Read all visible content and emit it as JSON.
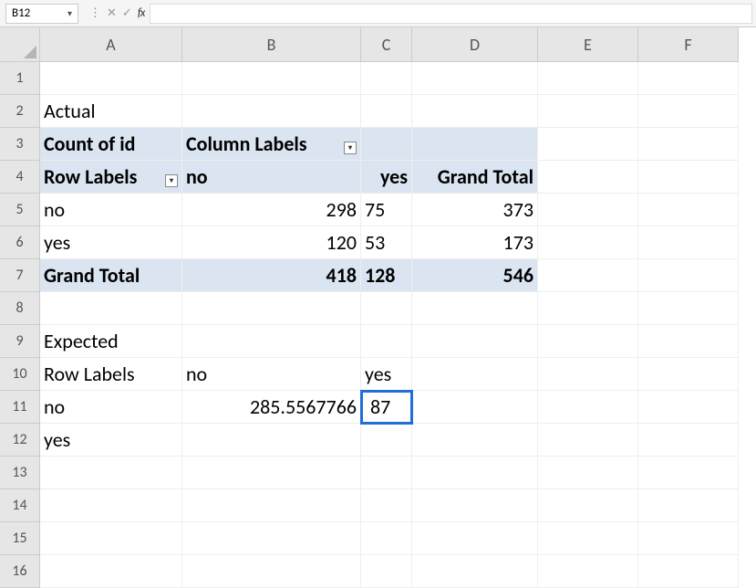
{
  "name_box": "B12",
  "fx_label": "fx",
  "columns": [
    "A",
    "B",
    "C",
    "D",
    "E",
    "F"
  ],
  "rows": [
    "1",
    "2",
    "3",
    "4",
    "5",
    "6",
    "7",
    "8",
    "9",
    "10",
    "11",
    "12",
    "13",
    "14",
    "15",
    "16"
  ],
  "cells": {
    "A2": "Actual",
    "A3": "Count of id",
    "B3": "Column Labels",
    "A4": "Row Labels",
    "B4": "no",
    "C4": "yes",
    "D4": "Grand Total",
    "A5": "no",
    "B5": "298",
    "C5": "75",
    "D5": "373",
    "A6": "yes",
    "B6": "120",
    "C6": "53",
    "D6": "173",
    "A7": "Grand Total",
    "B7": "418",
    "C7": "128",
    "D7": "546",
    "A9": "Expected",
    "A10": "Row Labels",
    "B10": "no",
    "C10": "yes",
    "A11": "no",
    "B11": "285.5567766",
    "C11": "87",
    "A12": "yes"
  }
}
